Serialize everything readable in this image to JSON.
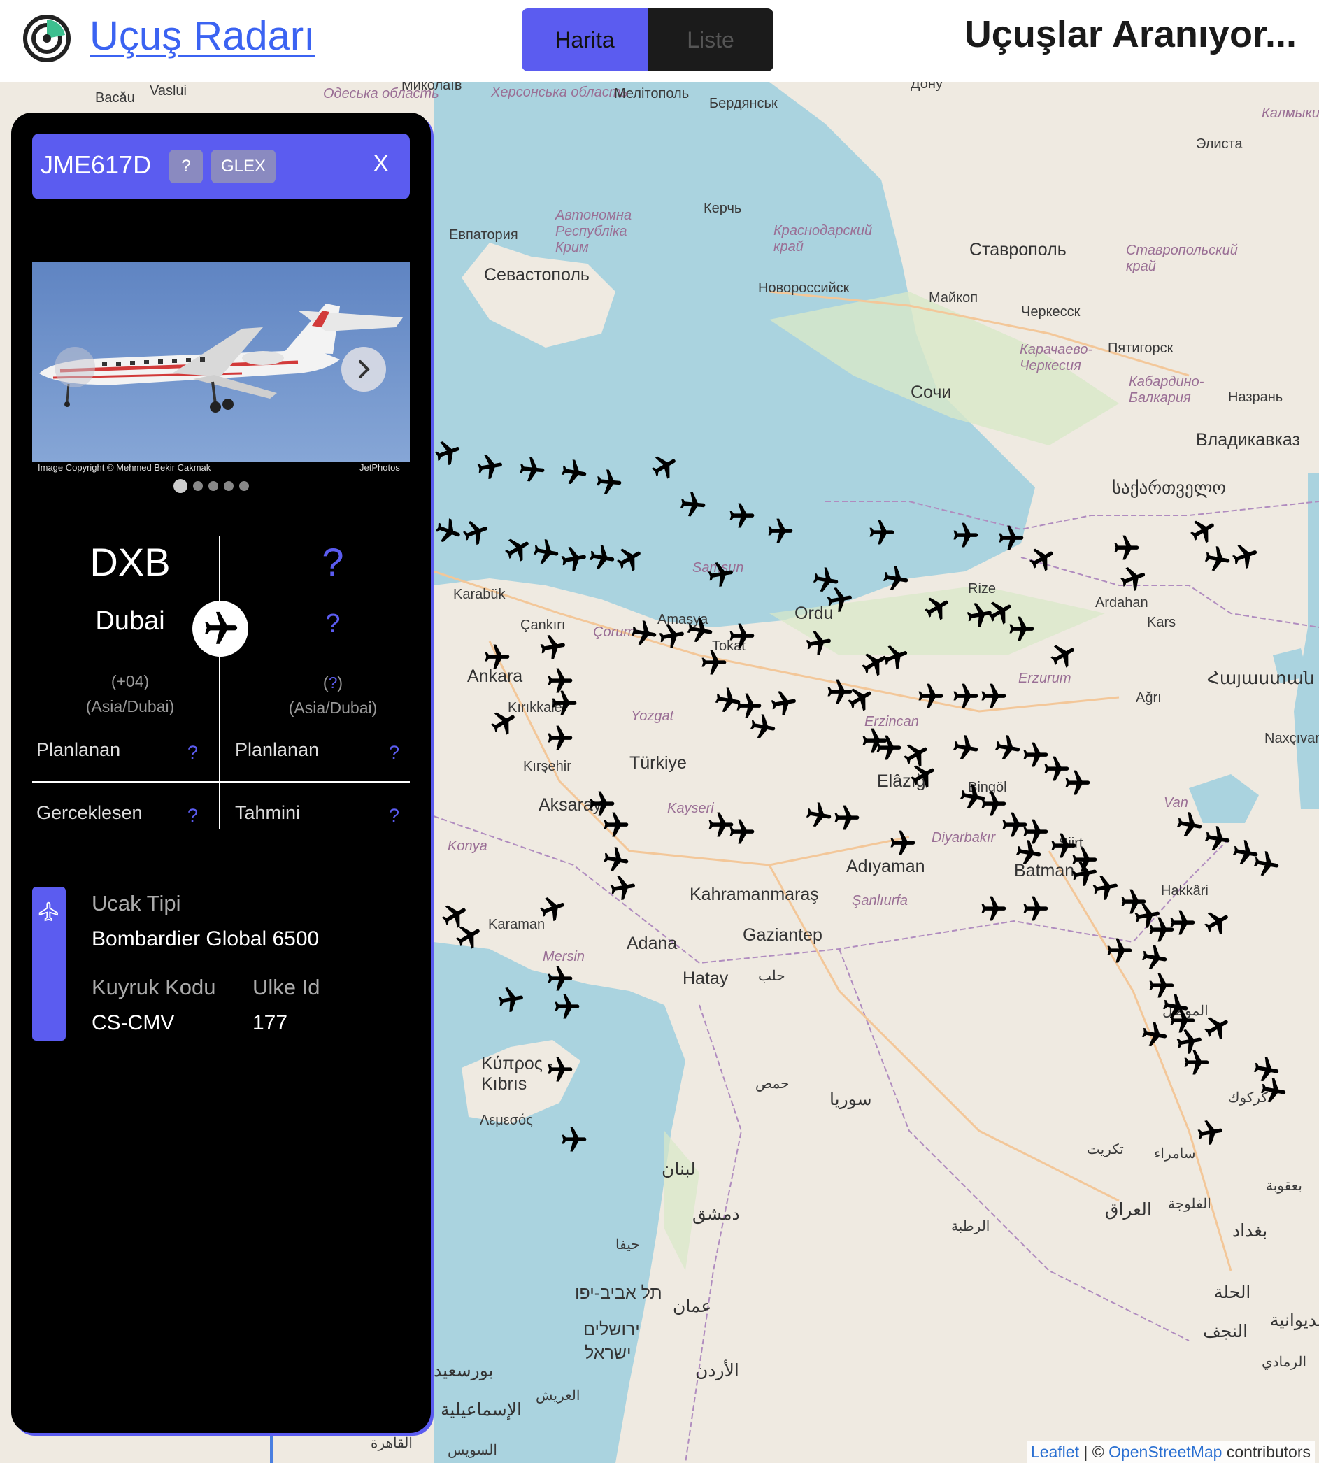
{
  "header": {
    "app_title": "Uçuş Radarı",
    "tabs": [
      {
        "label": "Harita",
        "active": true
      },
      {
        "label": "Liste",
        "active": false
      }
    ],
    "status": "Uçuşlar Aranıyor..."
  },
  "panel": {
    "callsign": "JME617D",
    "unknown_badge": "?",
    "aircraft_code": "GLEX",
    "close_label": "X",
    "photo": {
      "credit": "Image Copyright © Mehmed Bekir Cakmak",
      "source": "JetPhotos",
      "total": 5,
      "active_index": 0
    },
    "origin": {
      "code": "DXB",
      "city": "Dubai",
      "offset": "(+04)",
      "timezone": "(Asia/Dubai)",
      "scheduled_label": "Planlanan",
      "scheduled_value": "?",
      "actual_label": "Gerceklesen",
      "actual_value": "?"
    },
    "destination": {
      "code": "?",
      "city": "?",
      "offset_open": "(",
      "offset_value": "?",
      "offset_close": ")",
      "timezone": "(Asia/Dubai)",
      "scheduled_label": "Planlanan",
      "scheduled_value": "?",
      "estimated_label": "Tahmini",
      "estimated_value": "?"
    },
    "aircraft": {
      "type_label": "Ucak Tipi",
      "type_value": "Bombardier Global 6500",
      "tail_label": "Kuyruk Kodu",
      "tail_value": "CS-CMV",
      "country_label": "Ulke Id",
      "country_value": "177"
    }
  },
  "map": {
    "places": [
      {
        "name": "Bacău"
      },
      {
        "name": "Vaslui"
      },
      {
        "name": "Одеська область"
      },
      {
        "name": "Миколаїв"
      },
      {
        "name": "Херсонська область"
      },
      {
        "name": "Мелітополь"
      },
      {
        "name": "Бердянськ"
      },
      {
        "name": "Дону"
      },
      {
        "name": "Калмыки"
      },
      {
        "name": "Элиста"
      },
      {
        "name": "Автономна Республіка Крим"
      },
      {
        "name": "Керчь"
      },
      {
        "name": "Евпатория"
      },
      {
        "name": "Краснодарский край"
      },
      {
        "name": "Ставрополь"
      },
      {
        "name": "Ставропольский край"
      },
      {
        "name": "Севастополь"
      },
      {
        "name": "Новороссийск"
      },
      {
        "name": "Майкоп"
      },
      {
        "name": "Черкесск"
      },
      {
        "name": "Карачаево-Черкесия"
      },
      {
        "name": "Пятигорск"
      },
      {
        "name": "Сочи"
      },
      {
        "name": "Кабардино-Балкария"
      },
      {
        "name": "Назрань"
      },
      {
        "name": "Владикавказ"
      },
      {
        "name": "საქართველო"
      },
      {
        "name": "Samsun"
      },
      {
        "name": "Ordu"
      },
      {
        "name": "Rize"
      },
      {
        "name": "Ardahan"
      },
      {
        "name": "Kars"
      },
      {
        "name": "Karabük"
      },
      {
        "name": "Çankırı"
      },
      {
        "name": "Çorum"
      },
      {
        "name": "Amasya"
      },
      {
        "name": "Tokat"
      },
      {
        "name": "Ankara"
      },
      {
        "name": "Kırıkkale"
      },
      {
        "name": "Yozgat"
      },
      {
        "name": "Erzincan"
      },
      {
        "name": "Erzurum"
      },
      {
        "name": "Ağrı"
      },
      {
        "name": "Հայաստան"
      },
      {
        "name": "Naxçıvan"
      },
      {
        "name": "Kırşehir"
      },
      {
        "name": "Türkiye"
      },
      {
        "name": "Aksaray"
      },
      {
        "name": "Kayseri"
      },
      {
        "name": "Elâzığ"
      },
      {
        "name": "Bingöl"
      },
      {
        "name": "Van"
      },
      {
        "name": "Konya"
      },
      {
        "name": "Kahramanmaraş"
      },
      {
        "name": "Adıyaman"
      },
      {
        "name": "Diyarbakır"
      },
      {
        "name": "Batman"
      },
      {
        "name": "Siirt"
      },
      {
        "name": "Hakkâri"
      },
      {
        "name": "Karaman"
      },
      {
        "name": "Adana"
      },
      {
        "name": "Şanlıurfa"
      },
      {
        "name": "Gaziantep"
      },
      {
        "name": "Mersin"
      },
      {
        "name": "Hatay"
      },
      {
        "name": "Κύπρος - Kıbrıs"
      },
      {
        "name": "Λεμεσός"
      },
      {
        "name": "سوريا"
      },
      {
        "name": "لبنان"
      },
      {
        "name": "دمشق"
      },
      {
        "name": "العراق"
      },
      {
        "name": "بغداد"
      },
      {
        "name": "الأردن"
      },
      {
        "name": "عمان"
      },
      {
        "name": "ירושלים"
      },
      {
        "name": "תל אביב-יפו"
      },
      {
        "name": "ישראל"
      },
      {
        "name": "بورسعيد"
      },
      {
        "name": "الإسماعيلية"
      },
      {
        "name": "القاهرة"
      },
      {
        "name": "السويس"
      },
      {
        "name": "العريش"
      },
      {
        "name": "الموصل"
      },
      {
        "name": "كركوك"
      },
      {
        "name": "حلب"
      },
      {
        "name": "حمص"
      },
      {
        "name": "الحلة"
      },
      {
        "name": "النجف"
      },
      {
        "name": "الرمادي"
      },
      {
        "name": "الفلوجة"
      },
      {
        "name": "بعقوبة"
      },
      {
        "name": "سامراء"
      },
      {
        "name": "تكريت"
      },
      {
        "name": "الرطبة"
      },
      {
        "name": "حيفا"
      },
      {
        "name": "الديوانية"
      }
    ],
    "attribution": {
      "leaflet": "Leaflet",
      "separator": "| ©",
      "osm": "OpenStreetMap",
      "suffix": "contributors"
    }
  },
  "colors": {
    "accent": "#5b5cf0",
    "panel_bg": "#000000",
    "sea": "#aad3df",
    "land": "#efeae1",
    "link": "#3b63f2"
  }
}
